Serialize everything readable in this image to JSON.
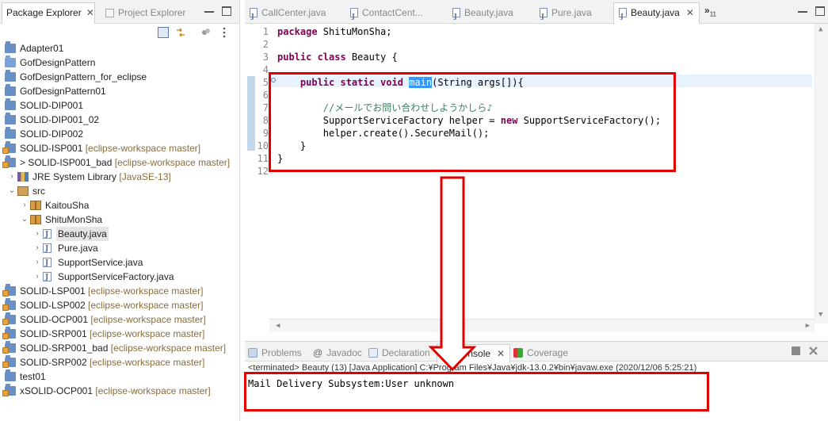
{
  "left_panel": {
    "tabs": [
      {
        "label": "Package Explorer",
        "active": true
      },
      {
        "label": "Project Explorer",
        "active": false
      }
    ],
    "tree": [
      {
        "label": "Adapter01",
        "deco": "",
        "level": 0,
        "icon": "project-icon",
        "chev": ""
      },
      {
        "label": "GofDesignPattern",
        "deco": "",
        "level": 0,
        "icon": "folder-icon",
        "chev": ""
      },
      {
        "label": "GofDesignPattern_for_eclipse",
        "deco": "",
        "level": 0,
        "icon": "project-icon",
        "chev": ""
      },
      {
        "label": "GofDesignPattern01",
        "deco": "",
        "level": 0,
        "icon": "project-icon",
        "chev": ""
      },
      {
        "label": "SOLID-DIP001",
        "deco": "",
        "level": 0,
        "icon": "project-icon",
        "chev": ""
      },
      {
        "label": "SOLID-DIP001_02",
        "deco": "",
        "level": 0,
        "icon": "project-icon",
        "chev": ""
      },
      {
        "label": "SOLID-DIP002",
        "deco": "",
        "level": 0,
        "icon": "project-icon",
        "chev": ""
      },
      {
        "label": "SOLID-ISP001",
        "deco": " [eclipse-workspace master]",
        "level": 0,
        "icon": "git-project-icon",
        "chev": ""
      },
      {
        "label": "> SOLID-ISP001_bad",
        "deco": " [eclipse-workspace master]",
        "level": 0,
        "icon": "git-project-icon",
        "chev": ""
      },
      {
        "label": "JRE System Library",
        "deco": " [JavaSE-13]",
        "level": 1,
        "icon": "library-icon",
        "chev": "›"
      },
      {
        "label": "src",
        "deco": "",
        "level": 1,
        "icon": "source-folder-icon",
        "chev": "⌄"
      },
      {
        "label": "KaitouSha",
        "deco": "",
        "level": 2,
        "icon": "package-icon",
        "chev": "›"
      },
      {
        "label": "ShituMonSha",
        "deco": "",
        "level": 2,
        "icon": "package-icon",
        "chev": "⌄"
      },
      {
        "label": "Beauty.java",
        "deco": "",
        "level": 3,
        "icon": "java-file-icon",
        "chev": "›",
        "selected": true
      },
      {
        "label": "Pure.java",
        "deco": "",
        "level": 3,
        "icon": "java-file-icon",
        "chev": "›"
      },
      {
        "label": "SupportService.java",
        "deco": "",
        "level": 3,
        "icon": "java-file-icon",
        "chev": "›"
      },
      {
        "label": "SupportServiceFactory.java",
        "deco": "",
        "level": 3,
        "icon": "java-file-icon",
        "chev": "›"
      },
      {
        "label": "SOLID-LSP001",
        "deco": " [eclipse-workspace master]",
        "level": 0,
        "icon": "git-project-icon",
        "chev": ""
      },
      {
        "label": "SOLID-LSP002",
        "deco": " [eclipse-workspace master]",
        "level": 0,
        "icon": "git-project-icon",
        "chev": ""
      },
      {
        "label": "SOLID-OCP001",
        "deco": " [eclipse-workspace master]",
        "level": 0,
        "icon": "git-project-icon",
        "chev": ""
      },
      {
        "label": "SOLID-SRP001",
        "deco": " [eclipse-workspace master]",
        "level": 0,
        "icon": "git-project-icon",
        "chev": ""
      },
      {
        "label": "SOLID-SRP001_bad",
        "deco": " [eclipse-workspace master]",
        "level": 0,
        "icon": "git-project-icon",
        "chev": ""
      },
      {
        "label": "SOLID-SRP002",
        "deco": " [eclipse-workspace master]",
        "level": 0,
        "icon": "git-project-icon",
        "chev": ""
      },
      {
        "label": "test01",
        "deco": "",
        "level": 0,
        "icon": "project-icon",
        "chev": ""
      },
      {
        "label": "xSOLID-OCP001",
        "deco": " [eclipse-workspace master]",
        "level": 0,
        "icon": "git-project-icon",
        "chev": ""
      }
    ]
  },
  "editor": {
    "tabs": [
      {
        "label": "CallCenter.java",
        "active": false
      },
      {
        "label": "ContactCent...",
        "active": false
      },
      {
        "label": "Beauty.java",
        "active": false
      },
      {
        "label": "Pure.java",
        "active": false
      },
      {
        "label": "Beauty.java",
        "active": true
      }
    ],
    "overflow_label": "»",
    "overflow_count": "11",
    "lines": [
      {
        "n": "1",
        "parts": [
          [
            "kw",
            "package"
          ],
          [
            "t",
            " ShituMonSha;"
          ]
        ]
      },
      {
        "n": "2",
        "parts": []
      },
      {
        "n": "3",
        "parts": [
          [
            "kw",
            "public class"
          ],
          [
            "t",
            " Beauty {"
          ]
        ]
      },
      {
        "n": "4",
        "parts": []
      },
      {
        "n": "5",
        "parts": [
          [
            "t",
            "    "
          ],
          [
            "kw",
            "public static void"
          ],
          [
            "t",
            " "
          ],
          [
            "sel",
            "main"
          ],
          [
            "t",
            "(String args[]){"
          ]
        ]
      },
      {
        "n": "6",
        "parts": []
      },
      {
        "n": "7",
        "parts": [
          [
            "t",
            "        "
          ],
          [
            "cm",
            "//メールでお問い合わせしようかしら♪"
          ]
        ]
      },
      {
        "n": "8",
        "parts": [
          [
            "t",
            "        SupportServiceFactory helper = "
          ],
          [
            "kw",
            "new"
          ],
          [
            "t",
            " SupportServiceFactory();"
          ]
        ]
      },
      {
        "n": "9",
        "parts": [
          [
            "t",
            "        helper.create().SecureMail();"
          ]
        ]
      },
      {
        "n": "10",
        "parts": [
          [
            "t",
            "    }"
          ]
        ]
      },
      {
        "n": "11",
        "parts": [
          [
            "t",
            "}"
          ]
        ]
      },
      {
        "n": "12",
        "parts": []
      }
    ]
  },
  "bottom_panel": {
    "tabs": [
      {
        "label": "Problems",
        "active": false
      },
      {
        "label": "Javadoc",
        "active": false
      },
      {
        "label": "Declaration",
        "active": false
      },
      {
        "label": "Console",
        "active": true
      },
      {
        "label": "Coverage",
        "active": false
      }
    ],
    "terminated_line": "<terminated> Beauty (13) [Java Application] C:¥Program Files¥Java¥jdk-13.0.2¥bin¥javaw.exe (2020/12/06 5:25:21)",
    "console_output": "Mail Delivery Subsystem:User unknown"
  },
  "colors": {
    "annotation_red": "#e00000",
    "keyword": "#7f0055",
    "comment": "#3f7f5f",
    "selection": "#3399ff",
    "git_decoration": "#8a6d3b"
  }
}
